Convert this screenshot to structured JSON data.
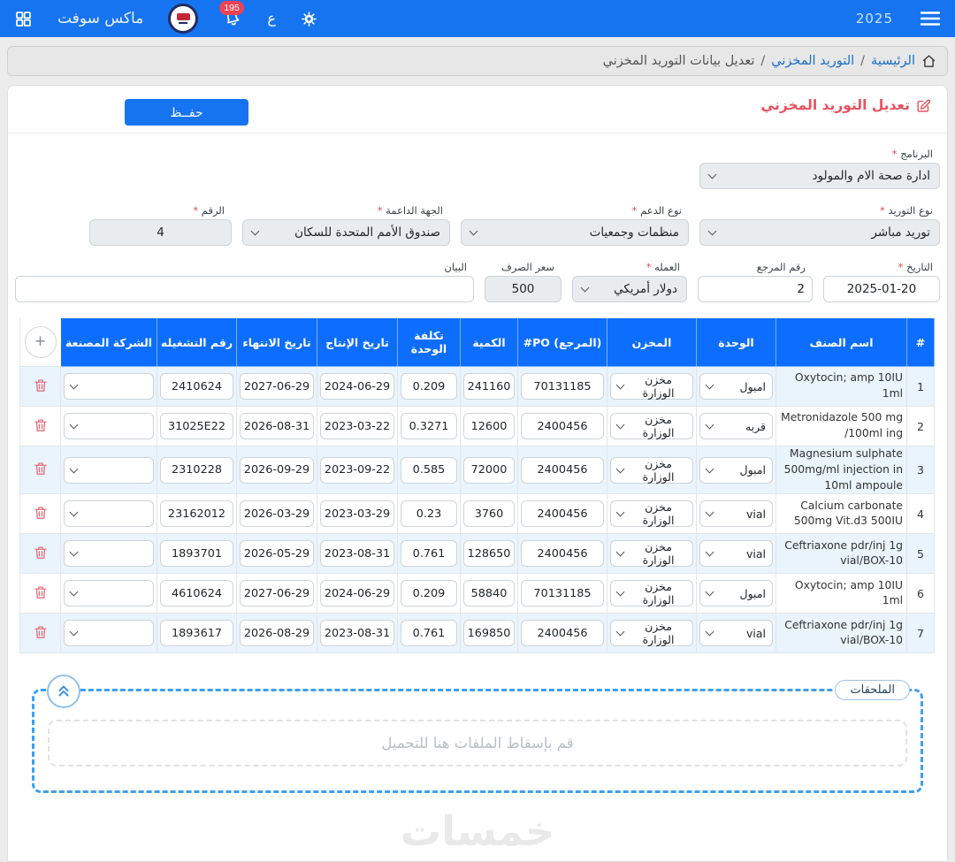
{
  "navbar": {
    "year": "2025",
    "language_label": "ع",
    "notifications_badge": "195",
    "brand": "ماكس سوفت"
  },
  "breadcrumb": {
    "home": "الرئيسية",
    "sep1": "/",
    "parent": "التوريد المخزني",
    "sep2": "/",
    "current": "تعديل بيانات التوريد المخزني"
  },
  "page": {
    "title": "تعديل التوريد المخزني",
    "save": "حفــظ"
  },
  "form": {
    "program": {
      "label": "البرنامج",
      "req": "*",
      "value": "ادارة صحة الام والمولود"
    },
    "supply_type": {
      "label": "نوع التوريد",
      "req": "*",
      "value": "توريد مباشر"
    },
    "support_type": {
      "label": "نوع الدعم",
      "req": "*",
      "value": "منظمات وجمعيات"
    },
    "donor": {
      "label": "الجهة الداعمة",
      "req": "*",
      "value": "صندوق الأمم المتحدة للسكان"
    },
    "number": {
      "label": "الرقم",
      "req": "*",
      "value": "4"
    },
    "date": {
      "label": "التاريخ",
      "req": "*",
      "value": "2025-01-20"
    },
    "reference": {
      "label": "رقم المرجع",
      "value": "2"
    },
    "currency": {
      "label": "العمله",
      "req": "*",
      "value": "دولار أمريكي"
    },
    "exchange_rate": {
      "label": "سعر الصرف",
      "value": "500"
    },
    "statement": {
      "label": "البيان",
      "value": ""
    }
  },
  "table": {
    "headers": [
      "#",
      "اسم الصنف",
      "الوحدة",
      "المخزن",
      "#PO (المرجع)",
      "الكمية",
      "تكلفة الوحدة",
      "تاريخ الإنتاج",
      "تاريخ الانتهاء",
      "رقم التشغيله",
      "الشركة المصنعة"
    ],
    "add_label": "+",
    "rows": [
      {
        "num": "1",
        "item": "Oxytocin; amp 10IU 1ml",
        "unit": "امبول",
        "warehouse": "مخزن الوزارة",
        "po": "70131185",
        "qty": "241160",
        "cost": "0.209",
        "prod_date": "2024-06-29",
        "exp_date": "2027-06-29",
        "batch": "2410624",
        "company": ""
      },
      {
        "num": "2",
        "item": "Metronidazole 500 mg /100ml ing",
        "unit": "قربه",
        "warehouse": "مخزن الوزارة",
        "po": "2400456",
        "qty": "12600",
        "cost": "0.3271",
        "prod_date": "2023-03-22",
        "exp_date": "2026-08-31",
        "batch": "31025E22",
        "company": ""
      },
      {
        "num": "3",
        "item": "Magnesium sulphate 500mg/ml injection in 10ml ampoule",
        "unit": "امبول",
        "warehouse": "مخزن الوزارة",
        "po": "2400456",
        "qty": "72000",
        "cost": "0.585",
        "prod_date": "2023-09-22",
        "exp_date": "2026-09-29",
        "batch": "2310228",
        "company": ""
      },
      {
        "num": "4",
        "item": "Calcium carbonate 500mg Vit.d3 500IU",
        "unit": "vial",
        "warehouse": "مخزن الوزارة",
        "po": "2400456",
        "qty": "3760",
        "cost": "0.23",
        "prod_date": "2023-03-29",
        "exp_date": "2026-03-29",
        "batch": "23162012",
        "company": ""
      },
      {
        "num": "5",
        "item": "Ceftriaxone pdr/inj 1g vial/BOX-10",
        "unit": "vial",
        "warehouse": "مخزن الوزارة",
        "po": "2400456",
        "qty": "128650",
        "cost": "0.761",
        "prod_date": "2023-08-31",
        "exp_date": "2026-05-29",
        "batch": "1893701",
        "company": ""
      },
      {
        "num": "6",
        "item": "Oxytocin; amp 10IU 1ml",
        "unit": "امبول",
        "warehouse": "مخزن الوزارة",
        "po": "70131185",
        "qty": "58840",
        "cost": "0.209",
        "prod_date": "2024-06-29",
        "exp_date": "2027-06-29",
        "batch": "4610624",
        "company": ""
      },
      {
        "num": "7",
        "item": "Ceftriaxone pdr/inj 1g vial/BOX-10",
        "unit": "vial",
        "warehouse": "مخزن الوزارة",
        "po": "2400456",
        "qty": "169850",
        "cost": "0.761",
        "prod_date": "2023-08-31",
        "exp_date": "2026-08-29",
        "batch": "1893617",
        "company": ""
      }
    ]
  },
  "attachments": {
    "title": "الملحقات",
    "dropzone": "قم بإسقاط الملفات هنا للتحميل"
  },
  "watermark": "خمسات"
}
